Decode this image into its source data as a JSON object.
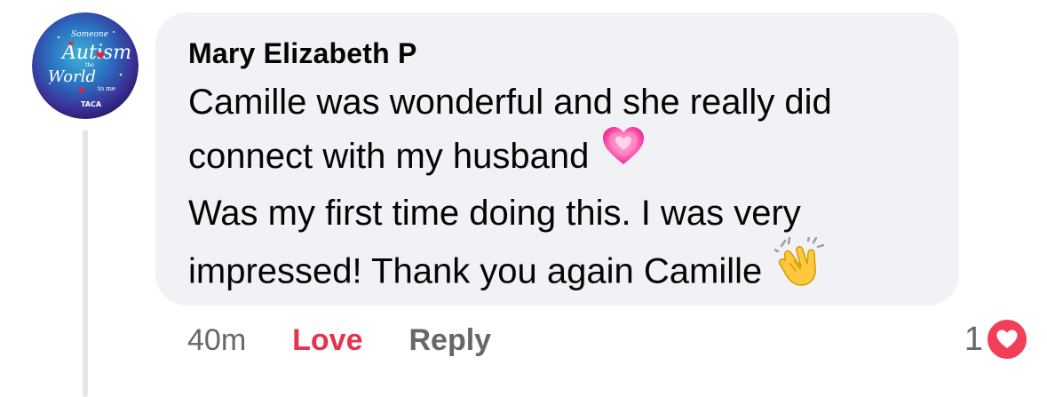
{
  "comment": {
    "avatar_icon": "autism-awareness-avatar",
    "avatar_lines": [
      "Someone",
      "Autism",
      "the",
      "World",
      "to me",
      "TACA"
    ],
    "author": "Mary Elizabeth P",
    "lines": [
      "Camille was wonderful and she really did",
      "connect with my husband",
      "Was my first time doing this. I was very",
      "impressed!  Thank you again Camille"
    ],
    "emojis": [
      "sparkling-heart-icon",
      "clapping-hands-icon"
    ]
  },
  "actions": {
    "time": "40m",
    "love_label": "Love",
    "reply_label": "Reply"
  },
  "reaction": {
    "count": "1",
    "icon": "heart-reaction-icon",
    "color": "#f33e58"
  },
  "colors": {
    "bubble": "#f0f2f5",
    "text": "#050505",
    "muted": "#65676b",
    "love": "#e4334e"
  }
}
